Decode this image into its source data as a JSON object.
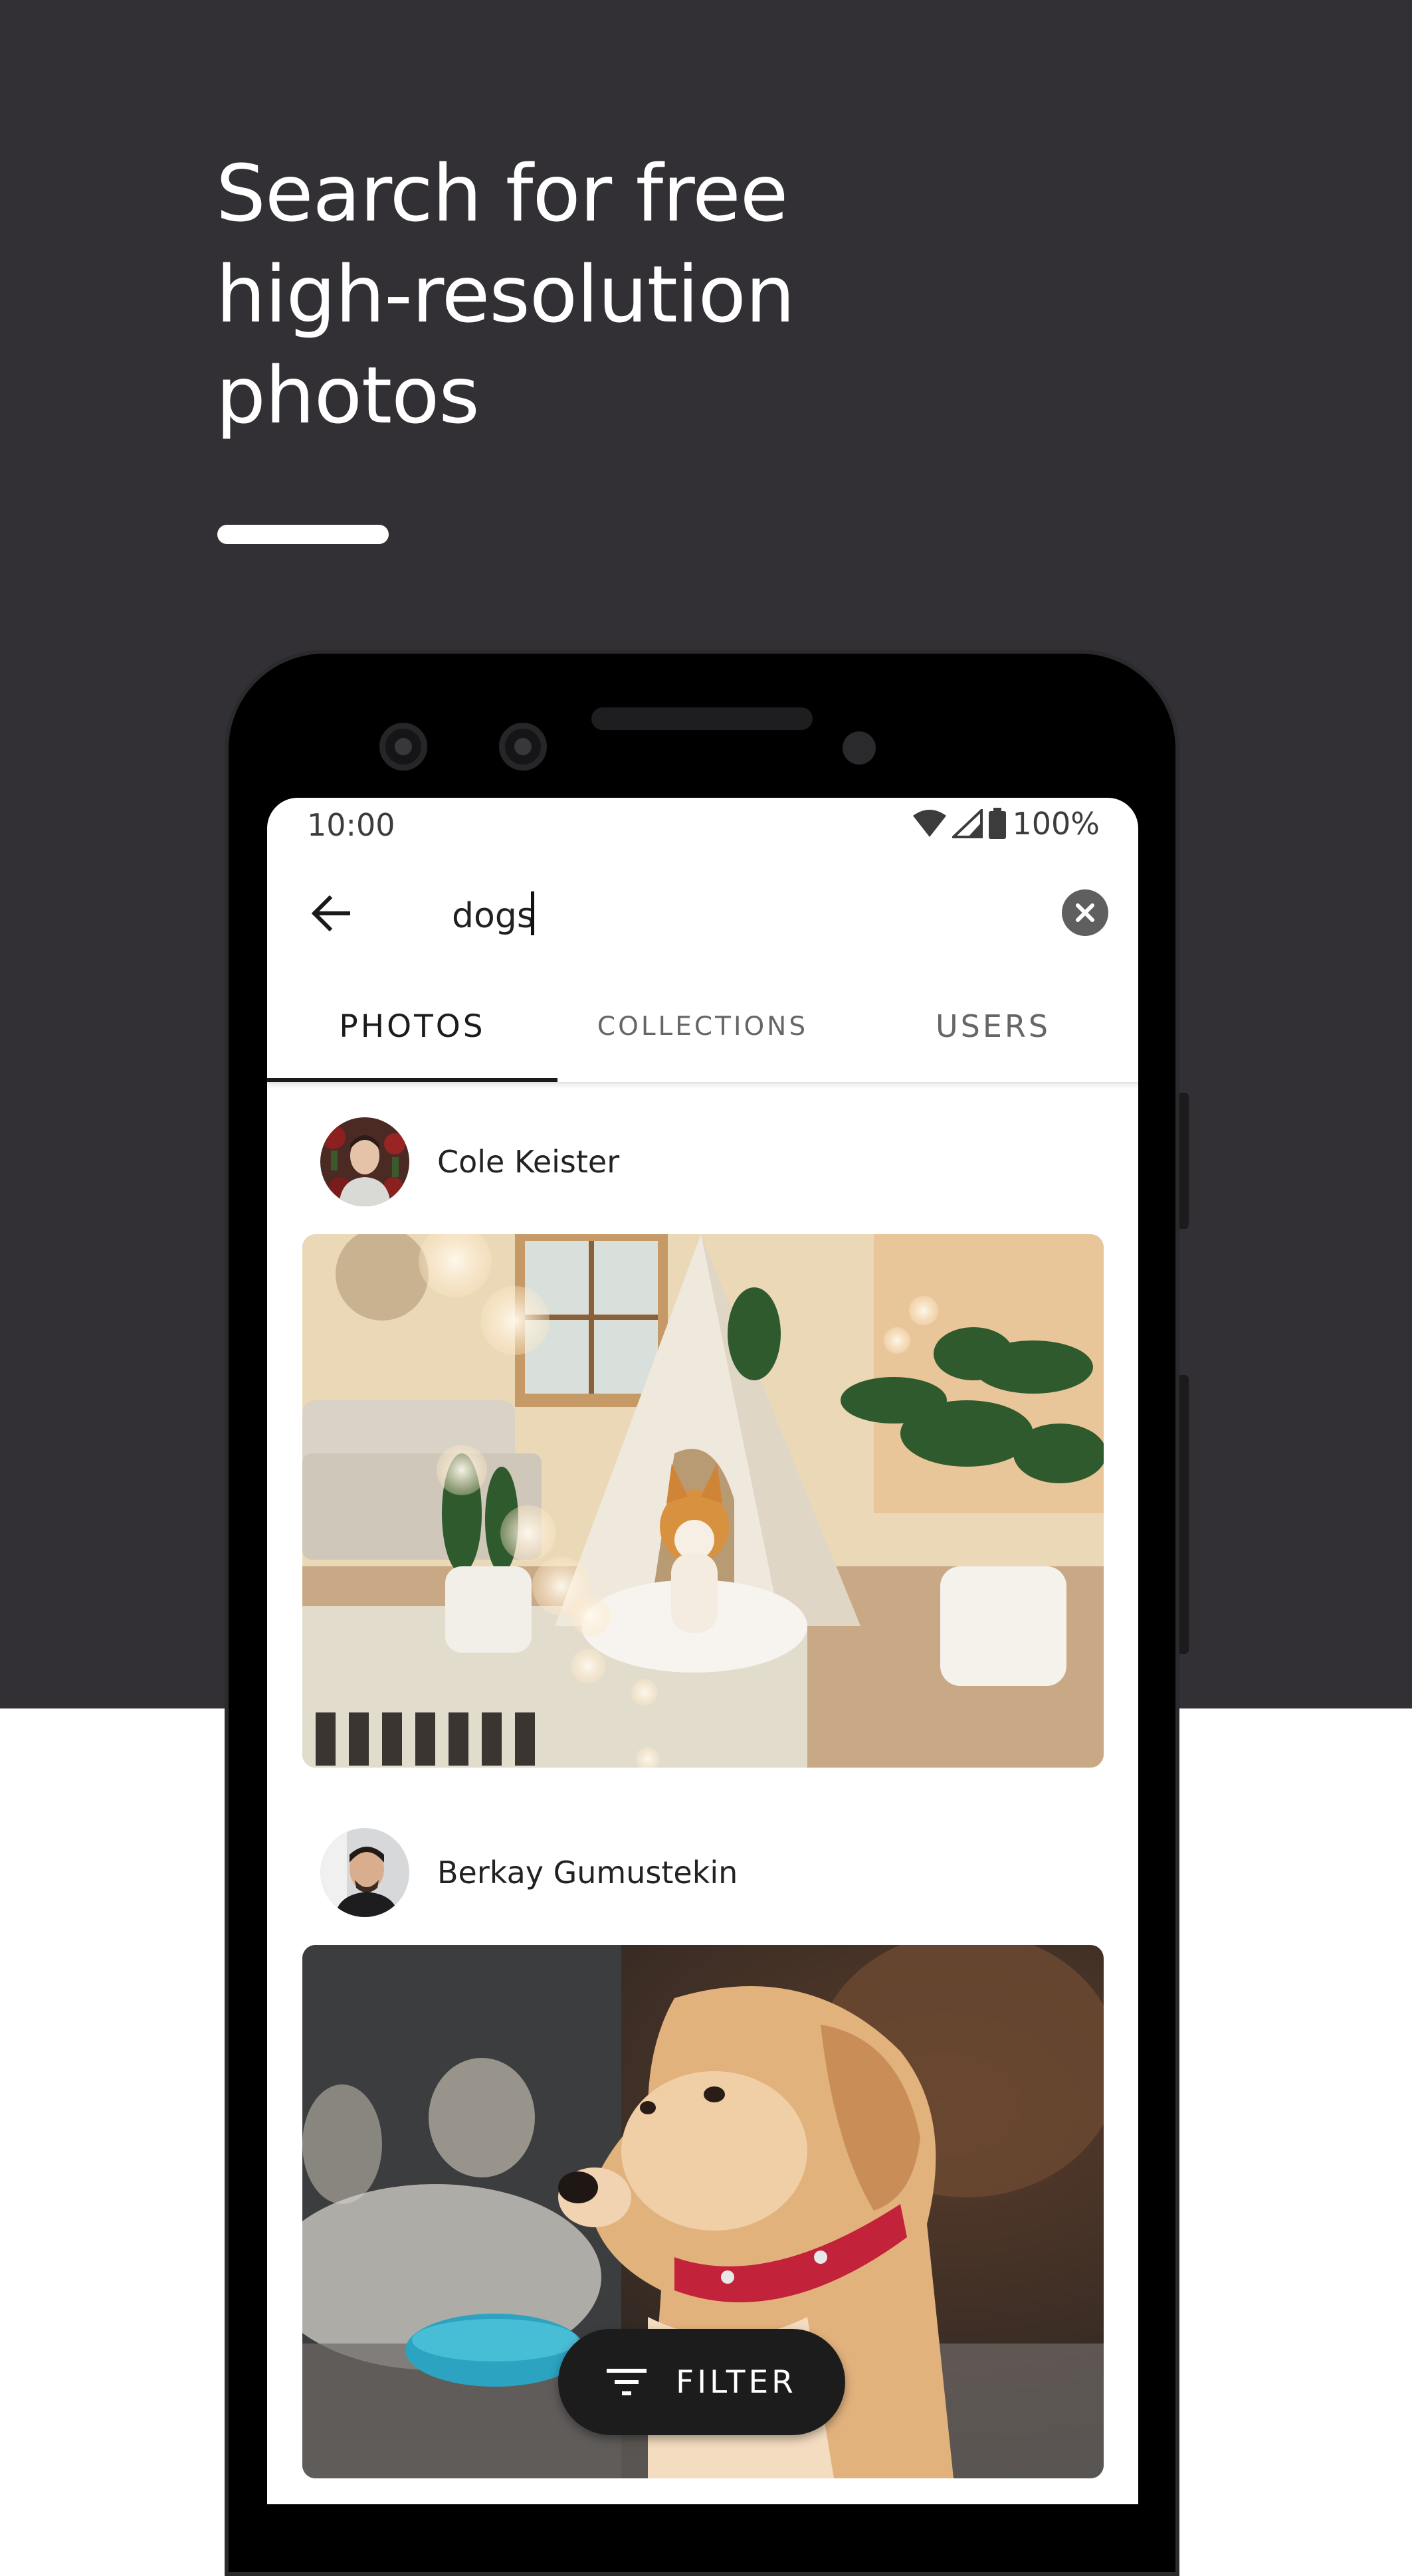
{
  "promo": {
    "headline_lines": [
      "Search for free",
      "high-resolution",
      "photos"
    ]
  },
  "status_bar": {
    "time": "10:00",
    "battery": "100%",
    "icons": [
      "wifi-icon",
      "cell-signal-icon",
      "battery-icon"
    ]
  },
  "search": {
    "back_icon": "arrow-back-icon",
    "query": "dogs",
    "clear_icon": "clear-circle-icon"
  },
  "tabs": [
    {
      "label": "PHOTOS",
      "active": true
    },
    {
      "label": "COLLECTIONS",
      "active": false
    },
    {
      "label": "USERS",
      "active": false
    }
  ],
  "feed": [
    {
      "user": "Cole Keister",
      "photo": "corgi sitting in a white teepee in a living room with plants"
    },
    {
      "user": "Berkay Gumustekin",
      "photo": "golden retriever puppy with a red collar"
    }
  ],
  "filter_button": {
    "label": "FILTER",
    "icon": "filter-list-icon"
  },
  "colors": {
    "promo_background": "#323035",
    "screen_background": "#ffffff",
    "filter_button": "#1c1c1c",
    "tab_active": "#1b1b1b",
    "tab_inactive": "#666666"
  }
}
